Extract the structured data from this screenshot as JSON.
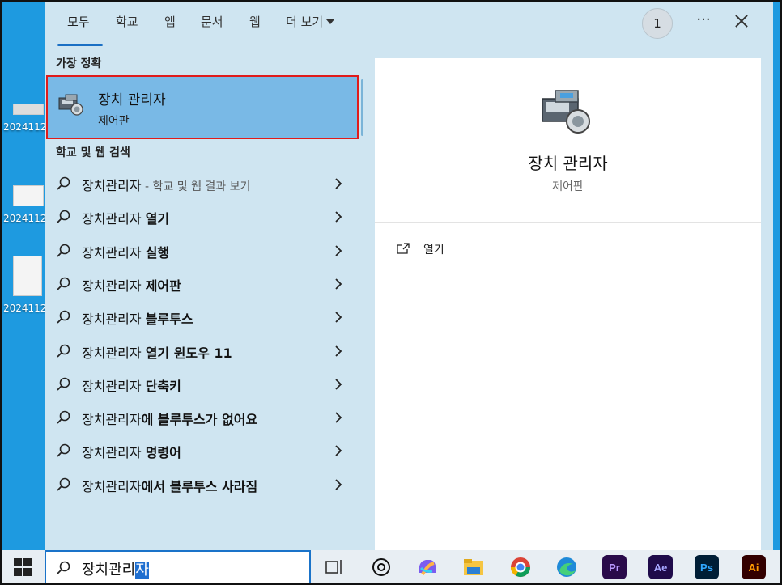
{
  "desktop": {
    "icons": [
      {
        "label": "2024112"
      },
      {
        "label": "2024112"
      },
      {
        "label": "2024112"
      }
    ]
  },
  "search": {
    "tabs": [
      {
        "label": "모두",
        "active": true
      },
      {
        "label": "학교"
      },
      {
        "label": "앱"
      },
      {
        "label": "문서"
      },
      {
        "label": "웹"
      },
      {
        "label": "더 보기"
      }
    ],
    "badge_count": "1",
    "more_label": "···",
    "best_match_heading": "가장 정확",
    "best_match": {
      "title": "장치 관리자",
      "subtitle": "제어판",
      "icon": "device-manager-icon"
    },
    "web_heading": "학교 및 웹 검색",
    "results": [
      {
        "prefix": "장치관리자",
        "bold": "",
        "hint": " - 학교 및 웹 결과 보기"
      },
      {
        "prefix": "장치관리자 ",
        "bold": "열기",
        "hint": ""
      },
      {
        "prefix": "장치관리자 ",
        "bold": "실행",
        "hint": ""
      },
      {
        "prefix": "장치관리자 ",
        "bold": "제어판",
        "hint": ""
      },
      {
        "prefix": "장치관리자 ",
        "bold": "블루투스",
        "hint": ""
      },
      {
        "prefix": "장치관리자 ",
        "bold": "열기 윈도우 11",
        "hint": ""
      },
      {
        "prefix": "장치관리자 ",
        "bold": "단축키",
        "hint": ""
      },
      {
        "prefix": "장치관리자",
        "bold": "에 블루투스가 없어요",
        "hint": ""
      },
      {
        "prefix": "장치관리자 ",
        "bold": "명령어",
        "hint": ""
      },
      {
        "prefix": "장치관리자",
        "bold": "에서 블루투스 사라짐",
        "hint": ""
      }
    ],
    "detail": {
      "title": "장치 관리자",
      "subtitle": "제어판",
      "actions": [
        {
          "label": "열기",
          "icon": "open-icon"
        }
      ]
    }
  },
  "taskbar": {
    "query_typed": "장치관리",
    "query_selected": "자",
    "apps": [
      {
        "name": "task-view",
        "label": ""
      },
      {
        "name": "chatgpt",
        "label": ""
      },
      {
        "name": "copilot",
        "label": ""
      },
      {
        "name": "file-explorer",
        "label": ""
      },
      {
        "name": "chrome",
        "label": ""
      },
      {
        "name": "edge",
        "label": ""
      },
      {
        "name": "premiere-pro",
        "label": "Pr"
      },
      {
        "name": "after-effects",
        "label": "Ae"
      },
      {
        "name": "photoshop",
        "label": "Ps"
      },
      {
        "name": "illustrator",
        "label": "Ai"
      }
    ]
  },
  "colors": {
    "desktop_bg": "#1e9ae0",
    "panel_bg": "#cfe5f1",
    "highlight": "#79b9e6",
    "highlight_border": "#e01b1b",
    "accent": "#1a6fc4"
  }
}
